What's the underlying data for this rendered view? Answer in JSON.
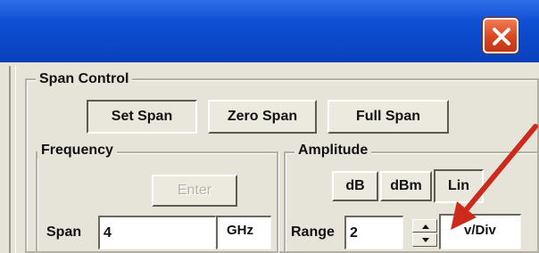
{
  "titlebar": {
    "close_icon": "close-icon",
    "color": "#0e4fd4",
    "close_color": "#d9461f"
  },
  "span_control": {
    "title": "Span Control",
    "buttons": [
      {
        "label": "Set Span",
        "pressed": true
      },
      {
        "label": "Zero Span",
        "pressed": false
      },
      {
        "label": "Full Span",
        "pressed": false
      }
    ]
  },
  "frequency": {
    "title": "Frequency",
    "enter_label": "Enter",
    "span_label": "Span",
    "span_value": "4",
    "span_unit": "GHz"
  },
  "amplitude": {
    "title": "Amplitude",
    "unit_buttons": [
      {
        "label": "dB",
        "pressed": false
      },
      {
        "label": "dBm",
        "pressed": false
      },
      {
        "label": "Lin",
        "pressed": true
      }
    ],
    "range_label": "Range",
    "range_value": "2",
    "range_unit": "v/Div"
  },
  "annotation": {
    "arrow_color": "#cc2a1c"
  }
}
